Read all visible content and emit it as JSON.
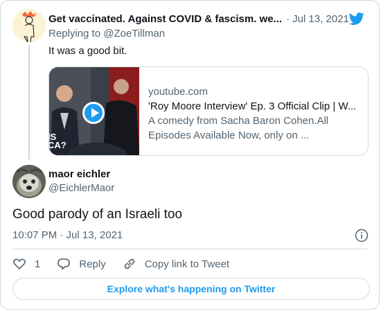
{
  "parent_tweet": {
    "author_name": "Get vaccinated. Against COVID & fascism. we...",
    "separator": "·",
    "date": "Jul 13, 2021",
    "replying_prefix": "Replying to ",
    "replying_handle": "@ZoeTillman",
    "text": "It was a good bit."
  },
  "link_card": {
    "thumb_caption": "IS CA?",
    "domain": "youtube.com",
    "title": "'Roy Moore Interview' Ep. 3 Official Clip | W...",
    "description": "A comedy from Sacha Baron Cohen.All Episodes Available Now, only on ..."
  },
  "main_tweet": {
    "author_name": "maor eichler",
    "handle": "@EichlerMaor",
    "text": "Good parody of an Israeli too",
    "timestamp": "10:07 PM · Jul 13, 2021"
  },
  "actions": {
    "like_count": "1",
    "reply_label": "Reply",
    "copy_link_label": "Copy link to Tweet"
  },
  "explore_label": "Explore what's happening on Twitter",
  "colors": {
    "accent": "#1d9bf0",
    "secondary_text": "#536471",
    "border": "#cfd9de"
  },
  "icons": [
    "twitter-bird-icon",
    "play-icon",
    "info-icon",
    "heart-icon",
    "reply-icon",
    "link-icon"
  ]
}
